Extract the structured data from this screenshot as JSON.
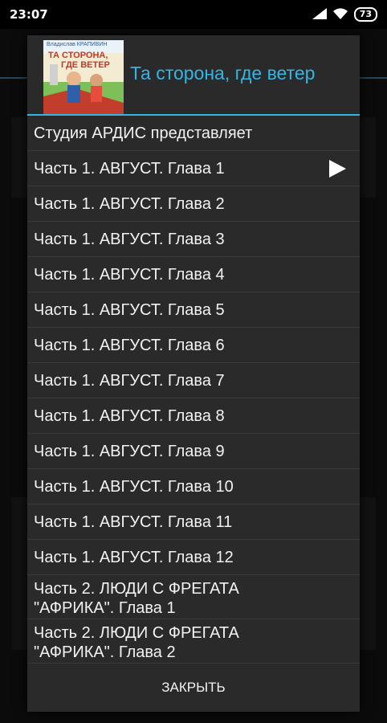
{
  "status_bar": {
    "time": "23:07",
    "battery": "73",
    "icons": [
      "signal-icon",
      "wifi-icon",
      "battery-icon"
    ]
  },
  "dialog": {
    "title": "Та сторона, где ветер",
    "cover": {
      "author": "Владислав КРАПИВИН",
      "title_line1": "ТА СТОРОНА,",
      "title_line2": "ГДЕ ВЕТЕР"
    },
    "items": [
      {
        "label": "Студия АРДИС представляет"
      },
      {
        "label": "Часть 1. АВГУСТ. Глава 1",
        "playing": true
      },
      {
        "label": "Часть 1. АВГУСТ. Глава 2"
      },
      {
        "label": "Часть 1. АВГУСТ. Глава 3"
      },
      {
        "label": "Часть 1. АВГУСТ. Глава 4"
      },
      {
        "label": "Часть 1. АВГУСТ. Глава 5"
      },
      {
        "label": "Часть 1. АВГУСТ. Глава 6"
      },
      {
        "label": "Часть 1. АВГУСТ. Глава 7"
      },
      {
        "label": "Часть 1. АВГУСТ. Глава 8"
      },
      {
        "label": "Часть 1. АВГУСТ. Глава 9"
      },
      {
        "label": "Часть 1. АВГУСТ. Глава 10"
      },
      {
        "label": "Часть 1. АВГУСТ. Глава 11"
      },
      {
        "label": "Часть 1. АВГУСТ. Глава 12"
      },
      {
        "label": "Часть 2. ЛЮДИ С ФРЕГАТА \"АФРИКА\". Глава 1"
      },
      {
        "label": "Часть 2. ЛЮДИ С ФРЕГАТА \"АФРИКА\". Глава 2"
      }
    ],
    "close_label": "ЗАКРЫТЬ"
  },
  "colors": {
    "accent": "#33b5e5",
    "dialog_bg": "#2a2a2a",
    "text": "#f2f2f2"
  }
}
